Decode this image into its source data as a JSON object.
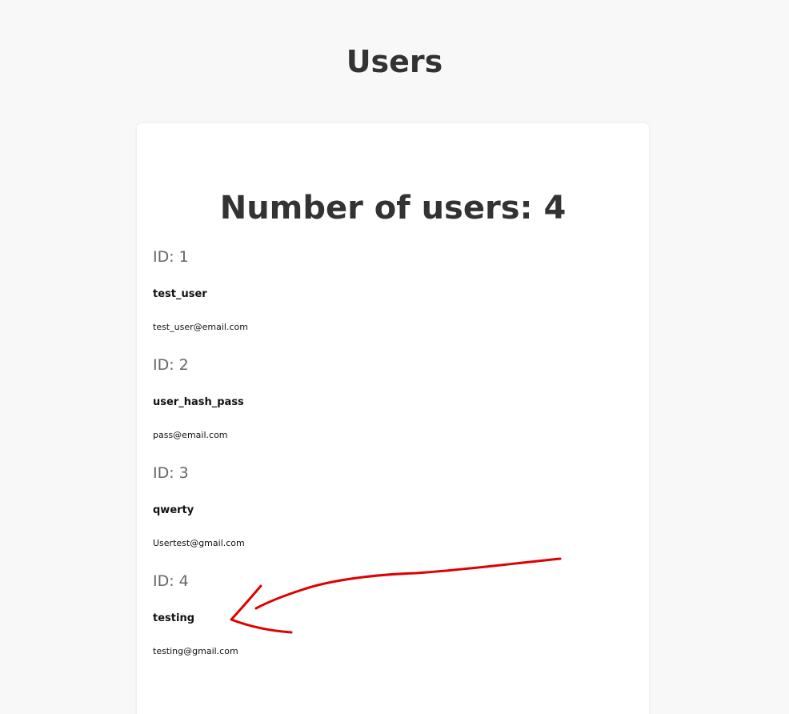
{
  "page": {
    "title": "Users"
  },
  "card": {
    "count_heading": "Number of users: 4"
  },
  "users": [
    {
      "id_label": "ID: 1",
      "username": "test_user",
      "email": "test_user@email.com"
    },
    {
      "id_label": "ID: 2",
      "username": "user_hash_pass",
      "email": "pass@email.com"
    },
    {
      "id_label": "ID: 3",
      "username": "qwerty",
      "email": "Usertest@gmail.com"
    },
    {
      "id_label": "ID: 4",
      "username": "testing",
      "email": "testing@gmail.com"
    }
  ],
  "annotation": {
    "arrow_color": "#e00000"
  },
  "colors": {
    "background": "#f8f8f8",
    "card": "#ffffff",
    "heading": "#333333",
    "id_text": "#666666"
  }
}
